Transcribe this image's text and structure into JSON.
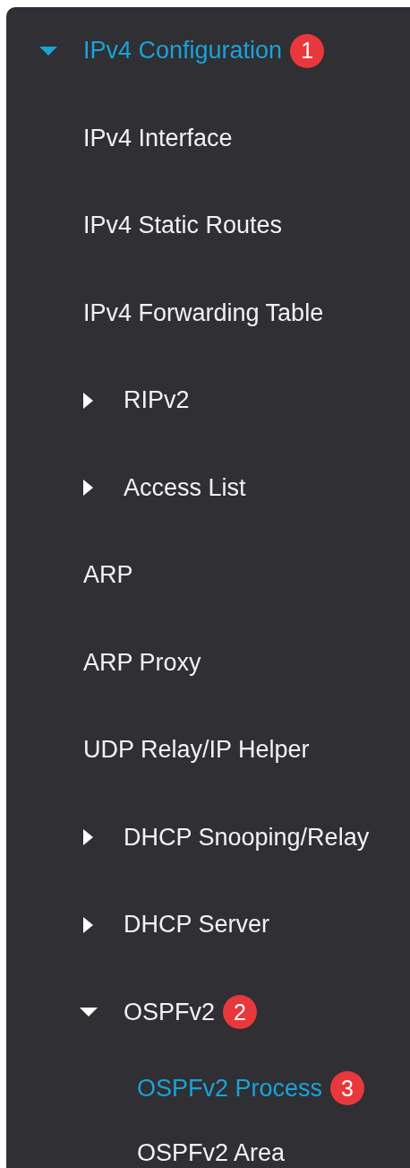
{
  "menu": {
    "label": "IPv4 Configuration",
    "kind": "group",
    "expanded": true,
    "selected": true,
    "badge": "1",
    "children": [
      {
        "label": "IPv4 Interface",
        "kind": "page",
        "selected": false
      },
      {
        "label": "IPv4 Static Routes",
        "kind": "page",
        "selected": false
      },
      {
        "label": "IPv4 Forwarding Table",
        "kind": "page",
        "selected": false
      },
      {
        "label": "RIPv2",
        "kind": "group",
        "expanded": false,
        "selected": false
      },
      {
        "label": "Access List",
        "kind": "group",
        "expanded": false,
        "selected": false
      },
      {
        "label": "ARP",
        "kind": "page",
        "selected": false
      },
      {
        "label": "ARP Proxy",
        "kind": "page",
        "selected": false
      },
      {
        "label": "UDP Relay/IP Helper",
        "kind": "page",
        "selected": false
      },
      {
        "label": "DHCP Snooping/Relay",
        "kind": "group",
        "expanded": false,
        "selected": false
      },
      {
        "label": "DHCP Server",
        "kind": "group",
        "expanded": false,
        "selected": false
      },
      {
        "label": "OSPFv2",
        "kind": "group",
        "expanded": true,
        "selected": false,
        "badge": "2",
        "children": [
          {
            "label": "OSPFv2 Process",
            "kind": "page",
            "selected": true,
            "badge": "3"
          },
          {
            "label": "OSPFv2 Area",
            "kind": "page",
            "selected": false
          }
        ]
      }
    ]
  }
}
